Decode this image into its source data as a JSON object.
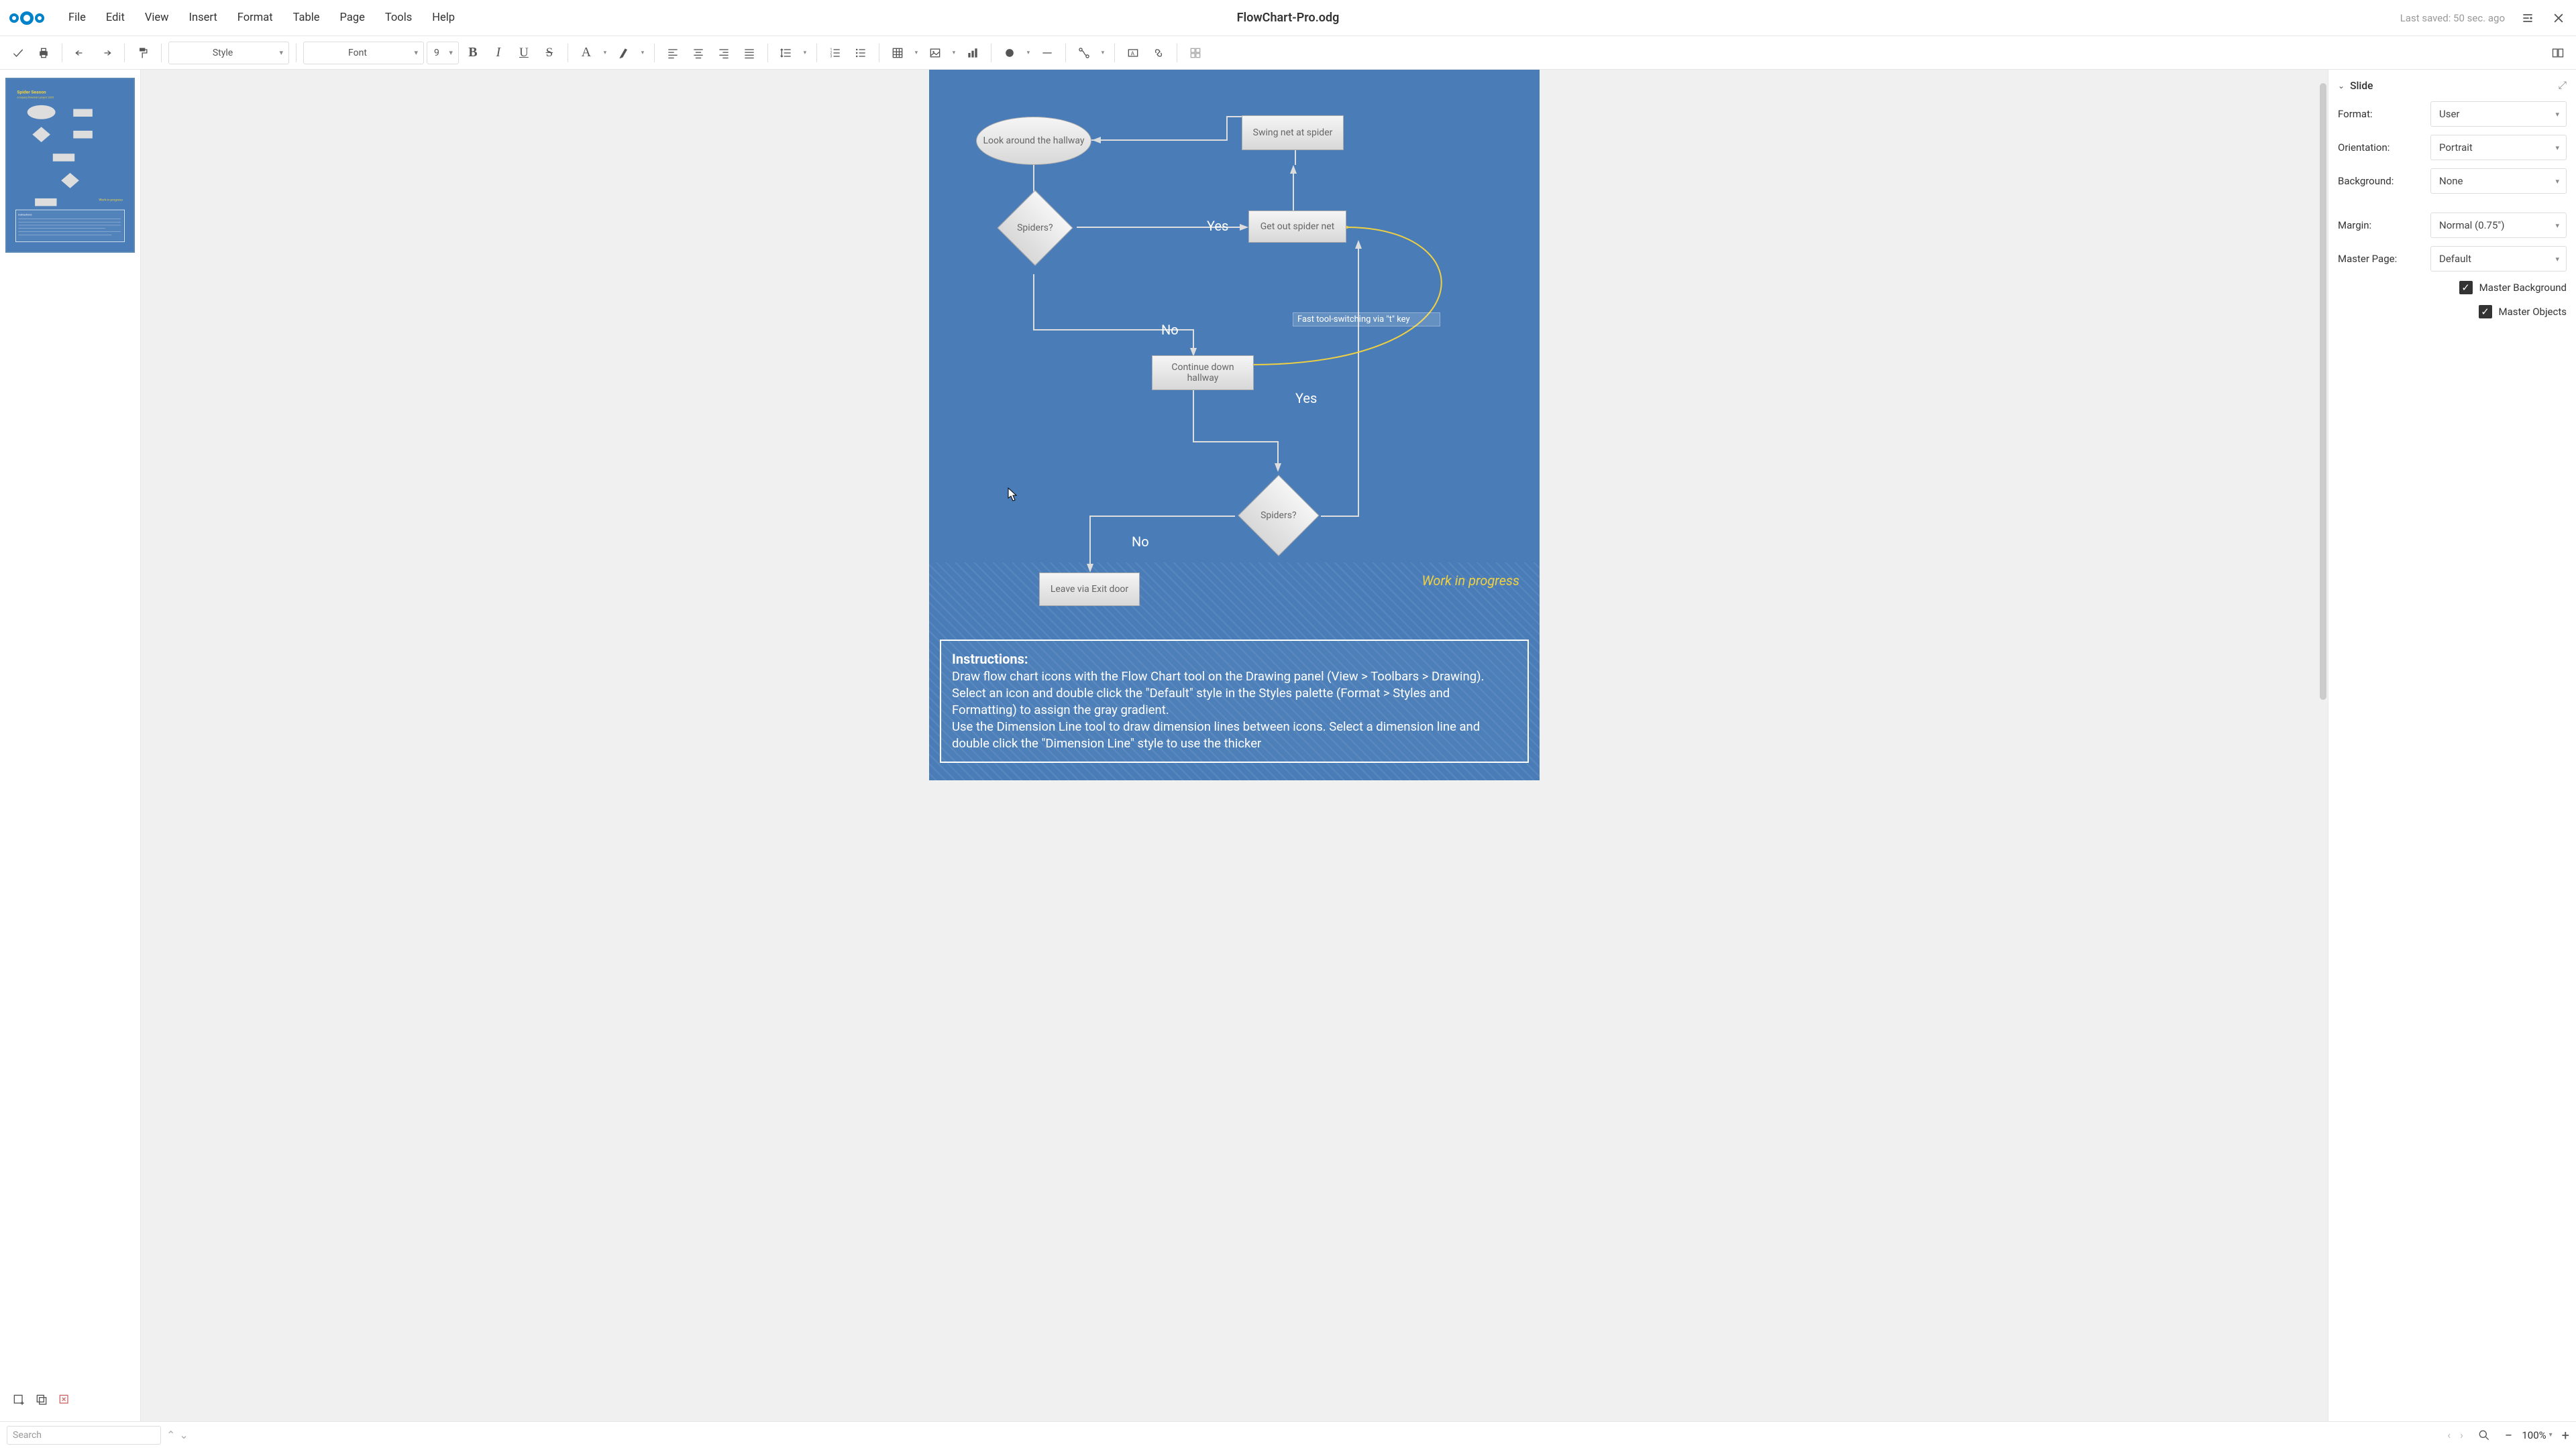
{
  "doc_title": "FlowChart-Pro.odg",
  "last_saved": "Last saved: 50 sec. ago",
  "menus": [
    "File",
    "Edit",
    "View",
    "Insert",
    "Format",
    "Table",
    "Page",
    "Tools",
    "Help"
  ],
  "toolbar": {
    "style_placeholder": "Style",
    "font_placeholder": "Font",
    "font_size": "9"
  },
  "props": {
    "section": "Slide",
    "format_label": "Format:",
    "format_value": "User",
    "orientation_label": "Orientation:",
    "orientation_value": "Portrait",
    "background_label": "Background:",
    "background_value": "None",
    "margin_label": "Margin:",
    "margin_value": "Normal (0.75\")",
    "master_page_label": "Master Page:",
    "master_page_value": "Default",
    "master_bg_label": "Master Background",
    "master_obj_label": "Master Objects"
  },
  "flowchart": {
    "n_look": "Look around the hallway",
    "n_swing": "Swing net at spider",
    "n_spiders1": "Spiders?",
    "n_getnet": "Get out spider net",
    "n_continue": "Continue down hallway",
    "n_spiders2": "Spiders?",
    "n_leave": "Leave via Exit door",
    "l_yes1": "Yes",
    "l_no1": "No",
    "l_yes2": "Yes",
    "l_no2": "No",
    "tooltip": "Fast tool-switching via \"t\" key",
    "wip": "Work in progress",
    "instr_title": "Instructions:",
    "instr_l1": "Draw flow chart icons with the Flow Chart tool on the Drawing panel (View > Toolbars > Drawing).",
    "instr_l2": "Select an icon and double click the \"Default\" style in the Styles palette (Format > Styles and Formatting) to assign the gray gradient.",
    "instr_l3": "Use the Dimension Line tool to draw dimension lines between icons. Select a dimension line and double click the \"Dimension Line\" style to use the thicker"
  },
  "status": {
    "search_placeholder": "Search",
    "zoom": "100%"
  }
}
